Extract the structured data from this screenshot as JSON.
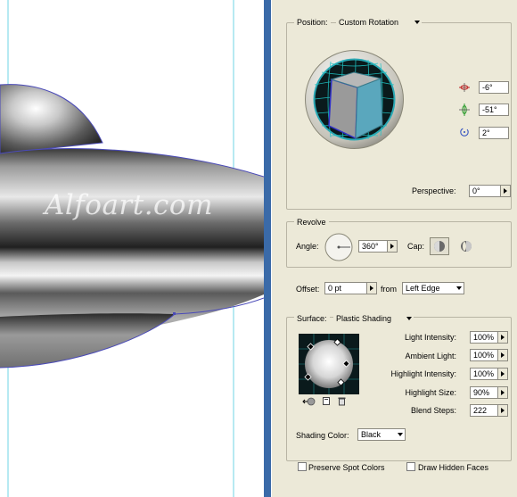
{
  "canvas": {
    "watermark": "Alfoart.com"
  },
  "position": {
    "label": "Position:",
    "preset": "Custom Rotation",
    "x_rotation": "-6°",
    "y_rotation": "-51°",
    "z_rotation": "2°",
    "perspective_label": "Perspective:",
    "perspective_value": "0°"
  },
  "revolve": {
    "legend": "Revolve",
    "angle_label": "Angle:",
    "angle_value": "360°",
    "cap_label": "Cap:",
    "offset_label": "Offset:",
    "offset_value": "0 pt",
    "from_label": "from",
    "from_value": "Left Edge"
  },
  "surface": {
    "label": "Surface:",
    "value": "Plastic Shading",
    "light_intensity_label": "Light Intensity:",
    "light_intensity_value": "100%",
    "ambient_light_label": "Ambient Light:",
    "ambient_light_value": "100%",
    "highlight_intensity_label": "Highlight Intensity:",
    "highlight_intensity_value": "100%",
    "highlight_size_label": "Highlight Size:",
    "highlight_size_value": "90%",
    "blend_steps_label": "Blend Steps:",
    "blend_steps_value": "222",
    "shading_color_label": "Shading Color:",
    "shading_color_value": "Black",
    "preserve_spot_label": "Preserve Spot Colors",
    "draw_hidden_label": "Draw Hidden Faces"
  },
  "colors": {
    "dialog_bg": "#ece9d8",
    "frame_blue": "#3a6aa8",
    "grid_teal": "#1ec6c6",
    "cube_face": "#5aa7bd"
  },
  "icons": [
    "rotate-x-icon",
    "rotate-y-icon",
    "rotate-z-icon",
    "cap-on-icon",
    "cap-off-icon",
    "back-light-icon",
    "new-light-icon",
    "delete-light-icon"
  ]
}
